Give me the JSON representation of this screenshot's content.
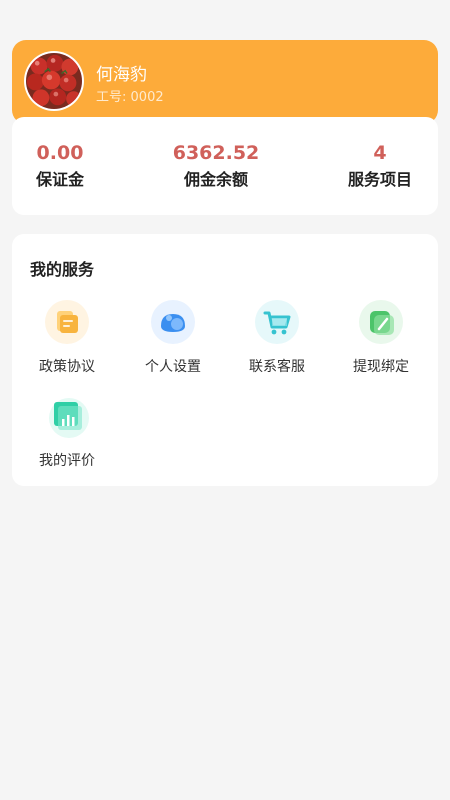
{
  "profile": {
    "name": "何海豹",
    "id_label": "工号:",
    "id_value": "0002",
    "header_color": "#fdab3a",
    "avatar_icon": "tomatoes-photo"
  },
  "stats": [
    {
      "value": "0.00",
      "label": "保证金"
    },
    {
      "value": "6362.52",
      "label": "佣金余额"
    },
    {
      "value": "4",
      "label": "服务项目"
    }
  ],
  "services": {
    "title": "我的服务",
    "items": [
      {
        "label": "政策协议",
        "icon": "policy-folder-icon",
        "color": "#f9b949"
      },
      {
        "label": "个人设置",
        "icon": "personal-settings-icon",
        "color": "#3b8ff0"
      },
      {
        "label": "联系客服",
        "icon": "shopping-cart-icon",
        "color": "#36c3d0"
      },
      {
        "label": "提现绑定",
        "icon": "withdraw-bind-icon",
        "color": "#4cc46a"
      },
      {
        "label": "我的评价",
        "icon": "my-review-icon",
        "color": "#2fcfa6"
      }
    ]
  },
  "accent_value_color": "#d0605a"
}
